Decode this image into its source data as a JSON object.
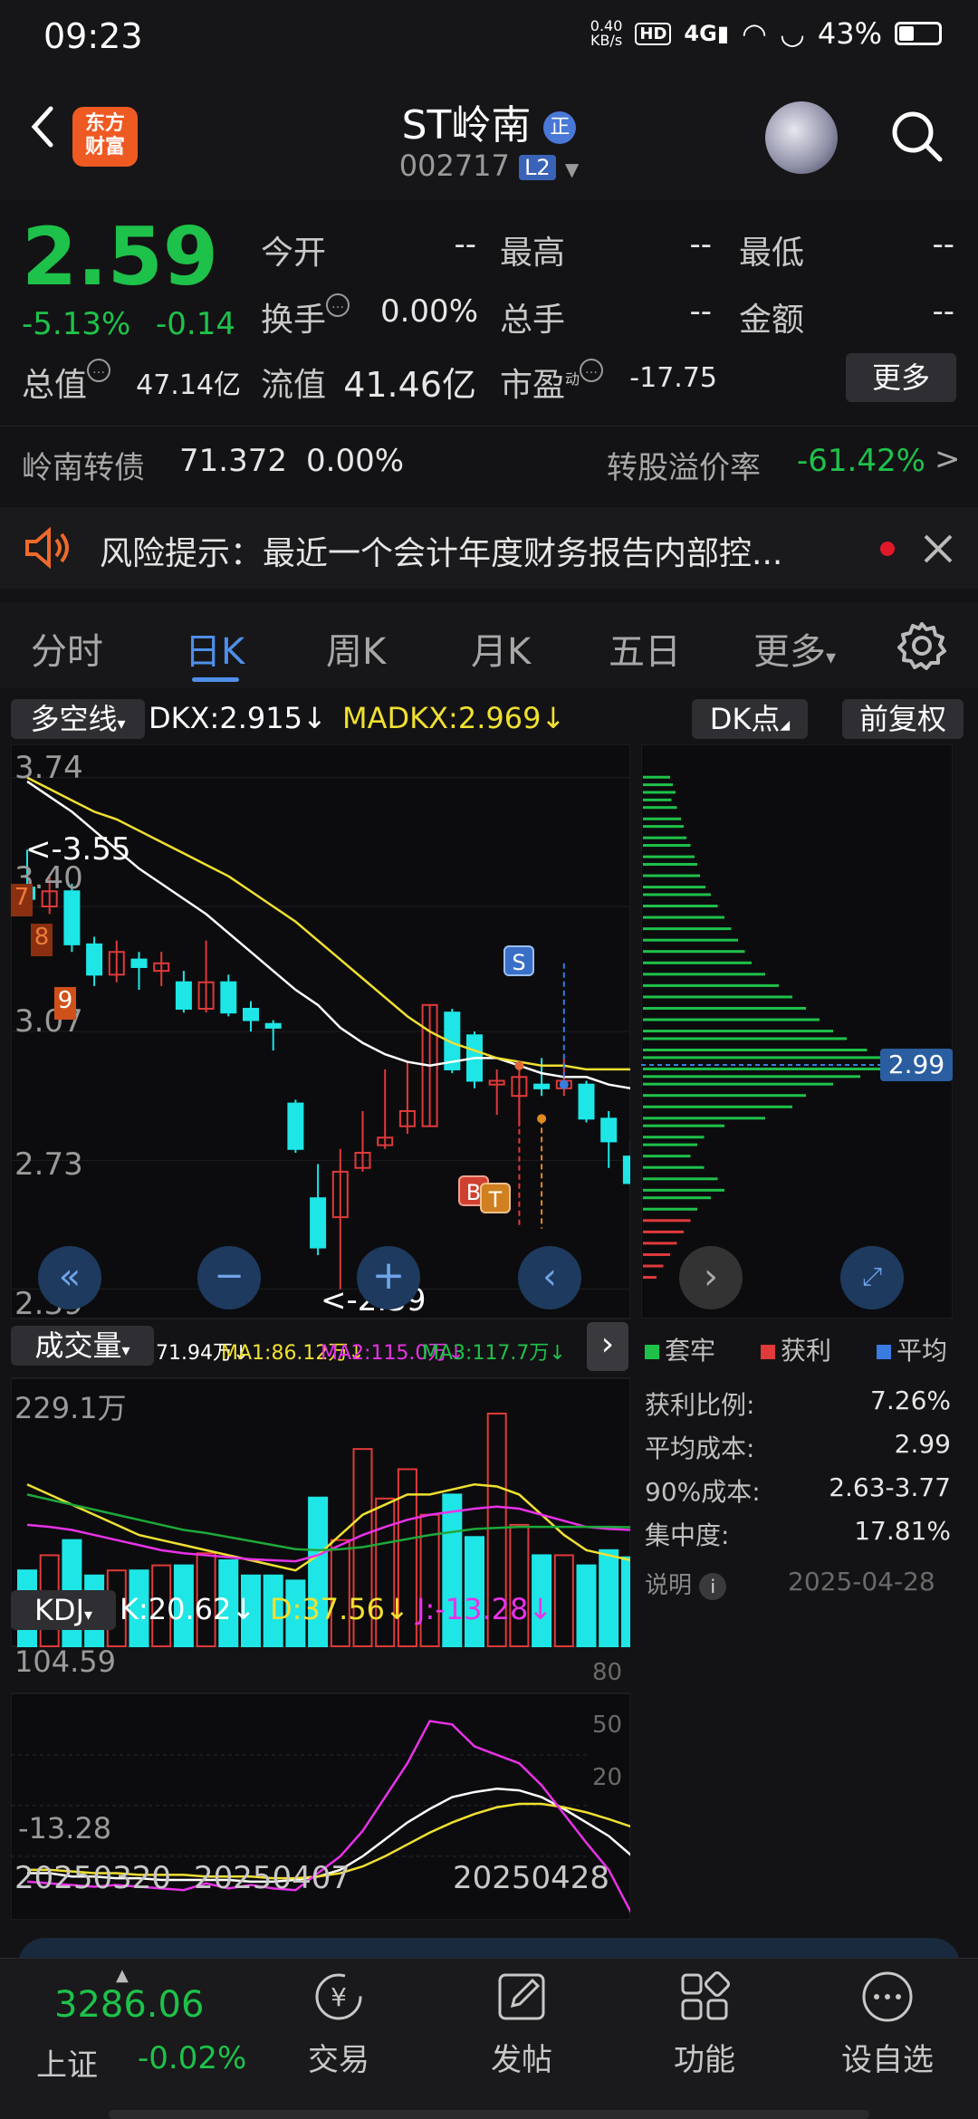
{
  "status_bar": {
    "time": "09:23",
    "speed_top": "0.40",
    "speed_bottom": "KB/s",
    "hd": "HD",
    "network": "4G",
    "battery": "43%"
  },
  "header": {
    "logo_line1": "东方",
    "logo_line2": "财富",
    "title": "ST岭南",
    "title_badge": "正",
    "code": "002717",
    "level": "L2"
  },
  "quote": {
    "price": "2.59",
    "change_pct": "-5.13%",
    "change": "-0.14",
    "open_label": "今开",
    "open": "--",
    "high_label": "最高",
    "high": "--",
    "low_label": "最低",
    "low": "--",
    "turnover_label": "换手",
    "turnover": "0.00%",
    "volume_label": "总手",
    "volume": "--",
    "amount_label": "金额",
    "amount": "--",
    "mktcap_label": "总值",
    "mktcap": "47.14亿",
    "float_label": "流值",
    "float": "41.46亿",
    "pe_label": "市盈",
    "pe_sup": "动",
    "pe": "-17.75",
    "more": "更多"
  },
  "bond": {
    "name": "岭南转债",
    "price": "71.372",
    "pct": "0.00%",
    "premium_label": "转股溢价率",
    "premium": "-61.42%",
    "arrow": ">"
  },
  "risk": {
    "text": "风险提示：最近一个会计年度财务报告内部控..."
  },
  "tabs": [
    {
      "label": "分时"
    },
    {
      "label": "日K"
    },
    {
      "label": "周K"
    },
    {
      "label": "月K"
    },
    {
      "label": "五日"
    },
    {
      "label": "更多"
    }
  ],
  "kline": {
    "indicator": "多空线",
    "dkx": "DKX:2.915↓",
    "madkx": "MADKX:2.969↓",
    "dk_point": "DK点",
    "adjust": "前复权",
    "y_labels": [
      "3.74",
      "3.40",
      "3.07",
      "2.73",
      "2.39"
    ],
    "high_marker": "<-3.55",
    "low_marker": "<-2.39",
    "badge_s": "S",
    "badge_b": "B",
    "badge_t": "T",
    "num7": "7",
    "num8": "8",
    "num9": "9",
    "chip_price": "2.99"
  },
  "volume": {
    "label": "成交量",
    "vol": "71.94万↓",
    "ma1": "MA1:86.12万↓",
    "ma2": "MA2:115.0万↓",
    "ma3": "MA3:117.7万↓",
    "max": "229.1万"
  },
  "kdj": {
    "label": "KDJ",
    "k": "K:20.62↓",
    "d": "D:37.56↓",
    "j": "J:-13.28↓",
    "max": "104.59",
    "min": "-13.28",
    "levels": [
      "80",
      "50",
      "20"
    ]
  },
  "x_labels": [
    "20250320",
    "20250407",
    "20250428"
  ],
  "chips": {
    "legend": [
      {
        "label": "套牢",
        "color": "#1ec24a"
      },
      {
        "label": "获利",
        "color": "#e03a3a"
      },
      {
        "label": "平均",
        "color": "#3a7be0"
      }
    ],
    "rows": [
      {
        "label": "获利比例:",
        "value": "7.26%"
      },
      {
        "label": "平均成本:",
        "value": "2.99"
      },
      {
        "label": "90%成本:",
        "value": "2.63-3.77"
      },
      {
        "label": "集中度:",
        "value": "17.81%"
      }
    ],
    "note": "说明",
    "date": "2025-04-28"
  },
  "bottom": {
    "index_value": "3286.06",
    "index_name": "上证",
    "index_pct": "-0.02%",
    "items": [
      {
        "label": "交易"
      },
      {
        "label": "发帖"
      },
      {
        "label": "功能"
      },
      {
        "label": "设自选"
      }
    ]
  },
  "chart_data": {
    "type": "candlestick",
    "y_ticks": [
      3.74,
      3.4,
      3.07,
      2.73,
      2.39
    ],
    "candles": [
      {
        "o": 3.45,
        "c": 3.42,
        "h": 3.55,
        "l": 3.4
      },
      {
        "o": 3.4,
        "c": 3.44,
        "h": 3.48,
        "l": 3.38
      },
      {
        "o": 3.44,
        "c": 3.3,
        "h": 3.46,
        "l": 3.28
      },
      {
        "o": 3.3,
        "c": 3.22,
        "h": 3.32,
        "l": 3.19
      },
      {
        "o": 3.22,
        "c": 3.28,
        "h": 3.31,
        "l": 3.2
      },
      {
        "o": 3.26,
        "c": 3.24,
        "h": 3.28,
        "l": 3.18
      },
      {
        "o": 3.23,
        "c": 3.25,
        "h": 3.28,
        "l": 3.19
      },
      {
        "o": 3.2,
        "c": 3.13,
        "h": 3.23,
        "l": 3.12
      },
      {
        "o": 3.13,
        "c": 3.2,
        "h": 3.31,
        "l": 3.12
      },
      {
        "o": 3.2,
        "c": 3.12,
        "h": 3.22,
        "l": 3.11
      },
      {
        "o": 3.13,
        "c": 3.1,
        "h": 3.15,
        "l": 3.07
      },
      {
        "o": 3.09,
        "c": 3.08,
        "h": 3.1,
        "l": 3.02
      },
      {
        "o": 2.88,
        "c": 2.76,
        "h": 2.89,
        "l": 2.75
      },
      {
        "o": 2.63,
        "c": 2.5,
        "h": 2.72,
        "l": 2.48
      },
      {
        "o": 2.58,
        "c": 2.7,
        "h": 2.76,
        "l": 2.39
      },
      {
        "o": 2.71,
        "c": 2.75,
        "h": 2.86,
        "l": 2.7
      },
      {
        "o": 2.77,
        "c": 2.79,
        "h": 2.97,
        "l": 2.76
      },
      {
        "o": 2.82,
        "c": 2.86,
        "h": 2.99,
        "l": 2.8
      },
      {
        "o": 2.82,
        "c": 3.14,
        "h": 3.14,
        "l": 2.82
      },
      {
        "o": 3.12,
        "c": 2.97,
        "h": 3.13,
        "l": 2.96
      },
      {
        "o": 3.06,
        "c": 2.94,
        "h": 3.07,
        "l": 2.92
      },
      {
        "o": 2.93,
        "c": 2.94,
        "h": 2.97,
        "l": 2.85
      },
      {
        "o": 2.9,
        "c": 2.95,
        "h": 2.98,
        "l": 2.82
      },
      {
        "o": 2.93,
        "c": 2.92,
        "h": 3.0,
        "l": 2.9
      },
      {
        "o": 2.92,
        "c": 2.94,
        "h": 3.0,
        "l": 2.9
      },
      {
        "o": 2.93,
        "c": 2.84,
        "h": 2.94,
        "l": 2.83
      },
      {
        "o": 2.84,
        "c": 2.78,
        "h": 2.86,
        "l": 2.71
      },
      {
        "o": 2.74,
        "c": 2.67,
        "h": 2.78,
        "l": 2.66
      }
    ],
    "dkx": [
      3.73,
      3.69,
      3.65,
      3.6,
      3.55,
      3.5,
      3.46,
      3.42,
      3.38,
      3.33,
      3.28,
      3.23,
      3.18,
      3.14,
      3.08,
      3.04,
      3.01,
      2.99,
      2.98,
      2.99,
      3.0,
      3.0,
      2.98,
      2.96,
      2.95,
      2.95,
      2.93,
      2.92
    ],
    "madkx": [
      3.74,
      3.71,
      3.68,
      3.65,
      3.63,
      3.6,
      3.57,
      3.54,
      3.51,
      3.48,
      3.44,
      3.4,
      3.36,
      3.31,
      3.26,
      3.21,
      3.16,
      3.11,
      3.07,
      3.04,
      3.02,
      3.0,
      2.99,
      2.98,
      2.98,
      2.97,
      2.97,
      2.97
    ],
    "volume": {
      "max": 229.1,
      "values": [
        75,
        90,
        105,
        70,
        75,
        75,
        80,
        80,
        92,
        85,
        70,
        70,
        65,
        147,
        105,
        195,
        146,
        175,
        130,
        150,
        108,
        230,
        120,
        90,
        90,
        80,
        95,
        88
      ],
      "ma1": [
        160,
        150,
        140,
        130,
        120,
        110,
        105,
        100,
        95,
        90,
        85,
        80,
        75,
        90,
        110,
        130,
        140,
        150,
        150,
        155,
        160,
        158,
        150,
        130,
        110,
        95,
        90,
        85
      ],
      "ma2": [
        120,
        118,
        115,
        110,
        105,
        100,
        95,
        92,
        90,
        88,
        86,
        85,
        84,
        90,
        100,
        110,
        118,
        125,
        130,
        133,
        136,
        138,
        136,
        130,
        124,
        118,
        116,
        115
      ],
      "ma3": [
        150,
        145,
        140,
        135,
        130,
        125,
        120,
        115,
        112,
        108,
        104,
        100,
        96,
        95,
        96,
        98,
        102,
        106,
        110,
        113,
        116,
        117,
        118,
        118,
        118,
        118,
        118,
        117.7
      ]
    },
    "kdj": {
      "k": [
        10,
        10,
        8,
        8,
        7,
        7,
        6,
        6,
        6,
        6,
        5,
        5,
        6,
        8,
        12,
        20,
        30,
        40,
        48,
        55,
        58,
        60,
        59,
        55,
        48,
        40,
        32,
        20.62
      ],
      "d": [
        12,
        12,
        11,
        10,
        10,
        9,
        9,
        9,
        8,
        8,
        8,
        7,
        7,
        8,
        10,
        14,
        20,
        27,
        34,
        40,
        45,
        49,
        51,
        51,
        49,
        46,
        42,
        37.56
      ],
      "j": [
        5,
        4,
        3,
        2,
        3,
        2,
        1,
        0,
        4,
        1,
        3,
        1,
        0,
        10,
        20,
        35,
        55,
        75,
        100,
        98,
        85,
        80,
        75,
        62,
        45,
        28,
        12,
        -13.28
      ]
    },
    "chips_levels": [
      {
        "price": 3.74,
        "v": 20
      },
      {
        "price": 3.72,
        "v": 22
      },
      {
        "price": 3.7,
        "v": 24
      },
      {
        "price": 3.68,
        "v": 21
      },
      {
        "price": 3.66,
        "v": 25
      },
      {
        "price": 3.63,
        "v": 28
      },
      {
        "price": 3.61,
        "v": 30
      },
      {
        "price": 3.58,
        "v": 32
      },
      {
        "price": 3.56,
        "v": 35
      },
      {
        "price": 3.53,
        "v": 38
      },
      {
        "price": 3.51,
        "v": 40
      },
      {
        "price": 3.48,
        "v": 42
      },
      {
        "price": 3.45,
        "v": 46
      },
      {
        "price": 3.43,
        "v": 50
      },
      {
        "price": 3.4,
        "v": 55
      },
      {
        "price": 3.37,
        "v": 60
      },
      {
        "price": 3.34,
        "v": 65
      },
      {
        "price": 3.31,
        "v": 70
      },
      {
        "price": 3.28,
        "v": 75
      },
      {
        "price": 3.25,
        "v": 80
      },
      {
        "price": 3.22,
        "v": 90
      },
      {
        "price": 3.19,
        "v": 100
      },
      {
        "price": 3.16,
        "v": 110
      },
      {
        "price": 3.13,
        "v": 120
      },
      {
        "price": 3.1,
        "v": 130
      },
      {
        "price": 3.07,
        "v": 140
      },
      {
        "price": 3.05,
        "v": 150
      },
      {
        "price": 3.02,
        "v": 165
      },
      {
        "price": 3.0,
        "v": 200
      },
      {
        "price": 2.97,
        "v": 180
      },
      {
        "price": 2.95,
        "v": 160
      },
      {
        "price": 2.93,
        "v": 140
      },
      {
        "price": 2.9,
        "v": 120
      },
      {
        "price": 2.87,
        "v": 110
      },
      {
        "price": 2.84,
        "v": 90
      },
      {
        "price": 2.82,
        "v": 60
      },
      {
        "price": 2.79,
        "v": 45
      },
      {
        "price": 2.77,
        "v": 40
      },
      {
        "price": 2.74,
        "v": 35
      },
      {
        "price": 2.71,
        "v": 45
      },
      {
        "price": 2.68,
        "v": 55
      },
      {
        "price": 2.65,
        "v": 60
      },
      {
        "price": 2.63,
        "v": 50
      },
      {
        "price": 2.6,
        "v": 40
      },
      {
        "price": 2.57,
        "v": 35
      },
      {
        "price": 2.54,
        "v": 30
      },
      {
        "price": 2.51,
        "v": 25
      },
      {
        "price": 2.48,
        "v": 20
      },
      {
        "price": 2.45,
        "v": 15
      },
      {
        "price": 2.42,
        "v": 10
      }
    ]
  }
}
